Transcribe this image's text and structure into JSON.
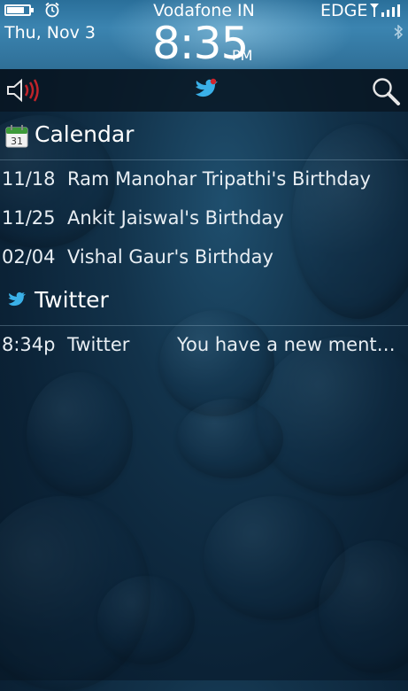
{
  "status_bar": {
    "date": "Thu, Nov 3",
    "carrier": "Vodafone IN",
    "time": "8:35",
    "ampm": "PM",
    "network": "EDGE",
    "battery_level": 0.8
  },
  "toolbar": {
    "left_icon": "speaker-volume-icon",
    "center_icon": "twitter-bird-notification-icon",
    "right_icon": "search-icon"
  },
  "calendar": {
    "title": "Calendar",
    "icon_day": "31",
    "items": [
      {
        "date": "11/18",
        "text": "Ram Manohar Tripathi's Birthday"
      },
      {
        "date": "11/25",
        "text": "Ankit Jaiswal's Birthday"
      },
      {
        "date": "02/04",
        "text": "Vishal Gaur's Birthday"
      }
    ]
  },
  "twitter": {
    "title": "Twitter",
    "items": [
      {
        "time": "8:34p",
        "source": "Twitter",
        "message": "You have a new ment…"
      }
    ]
  },
  "colors": {
    "status_bar": "#3b84b0",
    "background": "#0b2236",
    "speaker_waves": "#c0242a",
    "twitter_blue": "#3ab0e8"
  }
}
